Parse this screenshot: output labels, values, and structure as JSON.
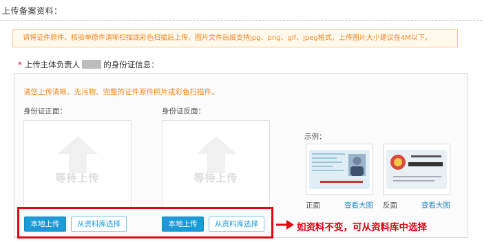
{
  "section_title": "上传备案资料：",
  "notice": "请将证件原件、核验单原件清晰扫描或彩色扫描后上传，图片文件后缀支持jpg、png、gif、jpeg格式，上传图片大小建议在4M以下。",
  "requirement": {
    "star": "*",
    "prefix": "上传主体负责人",
    "suffix": "的身份证信息："
  },
  "panel": {
    "hint": "请您上传清晰、无污物、完整的证件原件照片或彩色扫描件。",
    "front": {
      "label": "身份证正面：",
      "placeholder": "等待上传"
    },
    "back": {
      "label": "身份证反面：",
      "placeholder": "等待上传"
    },
    "example": {
      "label": "示例：",
      "front_caption": "正面",
      "back_caption": "反面",
      "view_large": "查看大图"
    }
  },
  "buttons": {
    "local_upload": "本地上传",
    "library_select": "从资料库选择"
  },
  "callout": "如资料不变，可从资料库中选择",
  "colors": {
    "accent_orange": "#f08a24",
    "primary_blue": "#1a9bd7",
    "highlight_red": "#e60012"
  }
}
